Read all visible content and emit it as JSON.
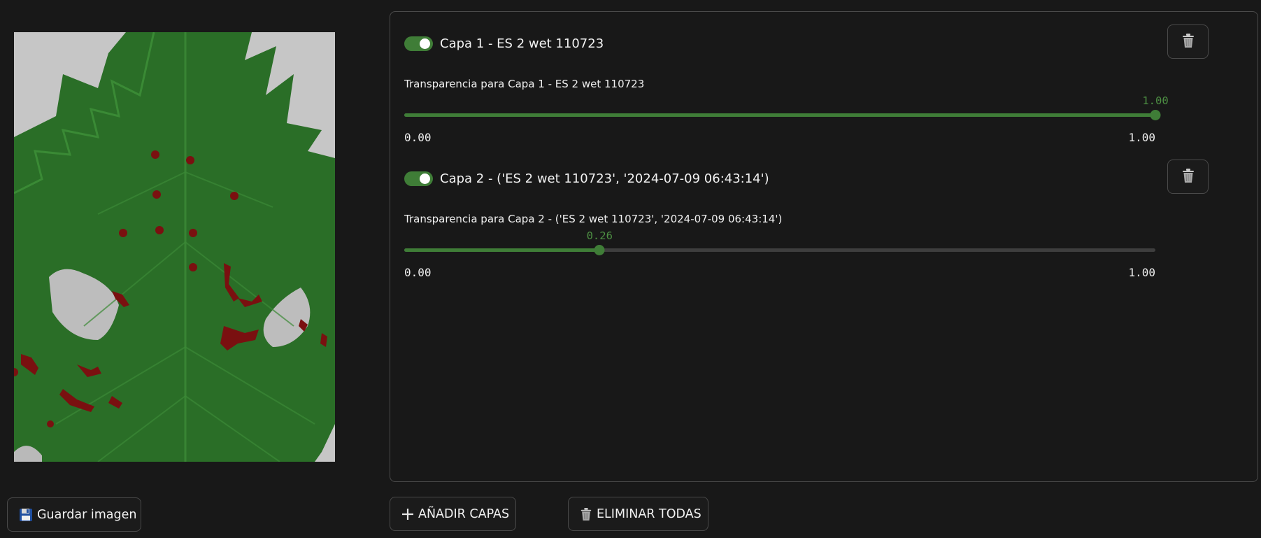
{
  "image": {
    "description_icon": "leaf-image",
    "colors": {
      "background": "#c9c9c9",
      "overlay": "#2b7a2b",
      "lesion": "#8b1010"
    }
  },
  "buttons": {
    "save": {
      "icon": "floppy-disk-icon",
      "label": "Guardar imagen"
    },
    "add_layers": {
      "icon": "plus-icon",
      "label": "AÑADIR CAPAS"
    },
    "clear_all": {
      "icon": "trash-icon",
      "label": "ELIMINAR TODAS"
    }
  },
  "layers": [
    {
      "enabled": true,
      "name": "Capa 1 - ES 2 wet 110723",
      "opacity_label": "Transparencia para Capa 1 - ES 2 wet 110723",
      "opacity": 1.0,
      "opacity_text": "1.00",
      "min_text": "0.00",
      "max_text": "1.00",
      "delete_icon": "trash-icon"
    },
    {
      "enabled": true,
      "name": "Capa 2 - ('ES 2 wet 110723', '2024-07-09 06:43:14')",
      "opacity_label": "Transparencia para Capa 2 - ('ES 2 wet 110723', '2024-07-09 06:43:14')",
      "opacity": 0.26,
      "opacity_text": "0.26",
      "min_text": "0.00",
      "max_text": "1.00",
      "delete_icon": "trash-icon"
    }
  ],
  "colors": {
    "accent": "#3f7d37",
    "background": "#181818",
    "border": "#4a4a4a"
  }
}
